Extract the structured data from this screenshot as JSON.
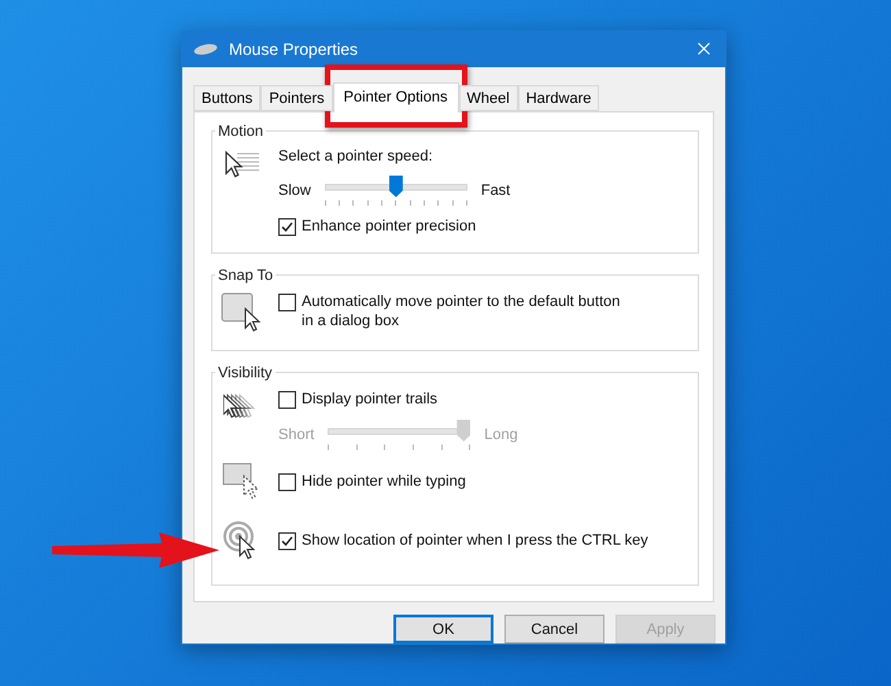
{
  "window": {
    "title": "Mouse Properties"
  },
  "tabs": [
    {
      "label": "Buttons",
      "selected": false
    },
    {
      "label": "Pointers",
      "selected": false
    },
    {
      "label": "Pointer Options",
      "selected": true
    },
    {
      "label": "Wheel",
      "selected": false
    },
    {
      "label": "Hardware",
      "selected": false
    }
  ],
  "motion": {
    "label": "Motion",
    "speed_label": "Select a pointer speed:",
    "slow": "Slow",
    "fast": "Fast",
    "level": 0.5,
    "enhance": {
      "label": "Enhance pointer precision",
      "checked": true
    }
  },
  "snap_to": {
    "label": "Snap To",
    "auto_move": {
      "label": "Automatically move pointer to the default button in a dialog box",
      "checked": false
    }
  },
  "visibility": {
    "label": "Visibility",
    "trails": {
      "label": "Display pointer trails",
      "checked": false
    },
    "trail_slider": {
      "short": "Short",
      "long": "Long",
      "level": 1,
      "disabled": true
    },
    "hide_typing": {
      "label": "Hide pointer while typing",
      "checked": false
    },
    "show_location": {
      "label": "Show location of pointer when I press the CTRL key",
      "checked": true
    }
  },
  "buttons": [
    {
      "label": "OK",
      "kind": "default"
    },
    {
      "label": "Cancel",
      "kind": "normal"
    },
    {
      "label": "Apply",
      "kind": "disabled"
    }
  ]
}
